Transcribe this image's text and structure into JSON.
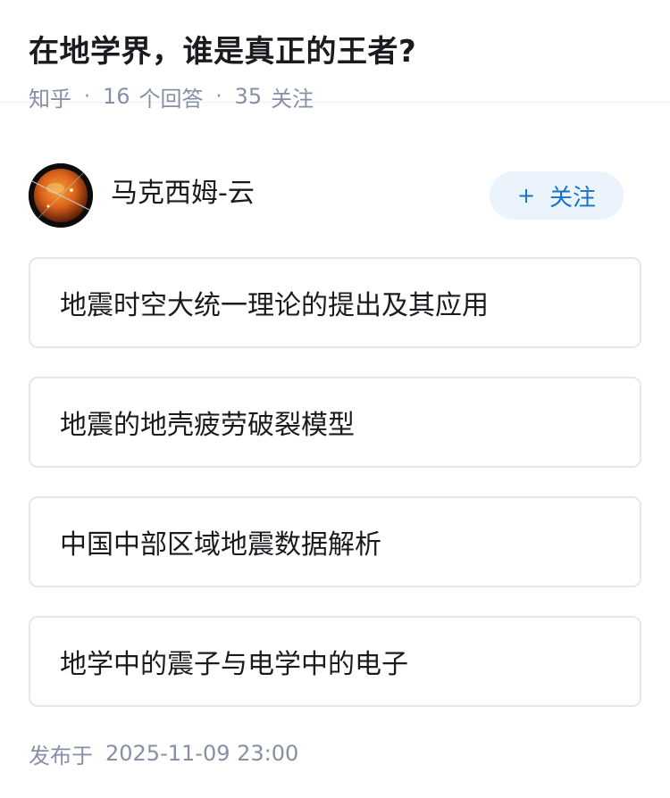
{
  "question": {
    "title": "在地学界，谁是真正的王者?",
    "source": "知乎",
    "separator": "·",
    "answers_count": "16",
    "answers_label": "个回答",
    "followers_count": "35",
    "followers_label": "关注"
  },
  "author": {
    "name": "马克西姆-云",
    "follow_plus": "+",
    "follow_label": "关注",
    "avatar_icon": "planet-avatar-icon"
  },
  "articles": [
    {
      "title": "地震时空大统一理论的提出及其应用"
    },
    {
      "title": "地震的地壳疲劳破裂模型"
    },
    {
      "title": "中国中部区域地震数据解析"
    },
    {
      "title": "地学中的震子与电学中的电子"
    }
  ],
  "footer": {
    "published_label": "发布于",
    "published_time": "2025-11-09 23:00"
  },
  "colors": {
    "accent": "#1772c6",
    "follow_bg": "#ebf4fc",
    "meta_text": "#8590a6",
    "card_border": "#e6e7ea"
  }
}
